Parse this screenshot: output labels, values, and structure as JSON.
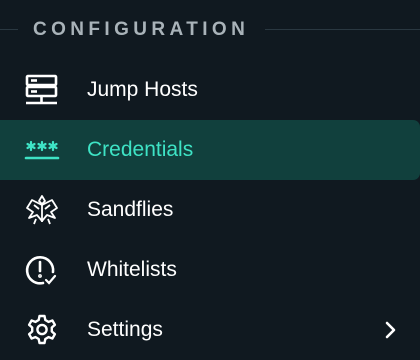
{
  "section": {
    "title": "CONFIGURATION"
  },
  "nav": {
    "items": [
      {
        "label": "Jump Hosts",
        "icon": "server-icon",
        "active": false
      },
      {
        "label": "Credentials",
        "icon": "password-icon",
        "active": true
      },
      {
        "label": "Sandflies",
        "icon": "sandfly-icon",
        "active": false
      },
      {
        "label": "Whitelists",
        "icon": "alert-check-icon",
        "active": false
      },
      {
        "label": "Settings",
        "icon": "gear-icon",
        "active": false,
        "has_submenu": true
      }
    ]
  },
  "colors": {
    "background": "#101920",
    "active_background": "#11403d",
    "accent": "#3ee3c5",
    "text": "#ffffff",
    "section_title": "#a9b3b9"
  }
}
